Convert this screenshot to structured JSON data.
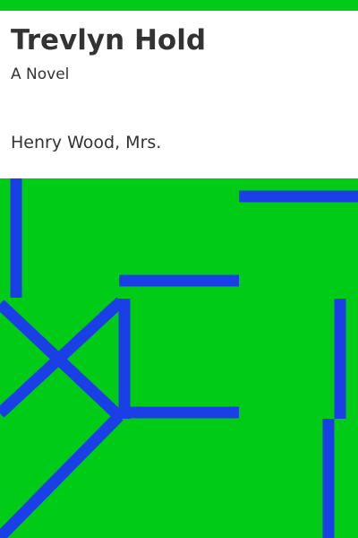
{
  "cover": {
    "title": "Trevlyn Hold",
    "subtitle": "A Novel",
    "author": "Henry Wood, Mrs."
  },
  "colors": {
    "background": "#00cc17",
    "panel": "#ffffff",
    "text": "#333333",
    "lines": "#1a3fe6"
  }
}
